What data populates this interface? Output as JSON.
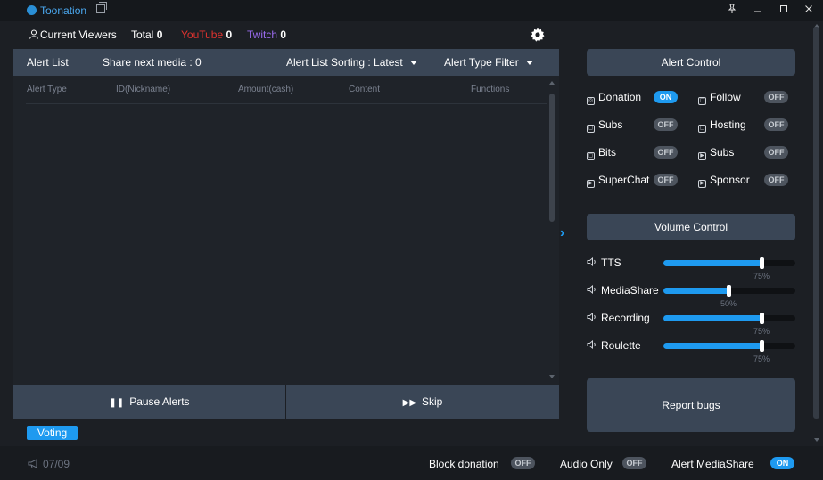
{
  "window": {
    "app_title": "Toonation",
    "icons": [
      "toonation-logo-icon",
      "restore-window-icon",
      "pin-icon",
      "minimize-icon",
      "maximize-icon",
      "close-icon"
    ]
  },
  "stats": {
    "viewers_label": "Current Viewers",
    "total_label": "Total",
    "total_value": "0",
    "youtube_label": "YouTube",
    "youtube_value": "0",
    "twitch_label": "Twitch",
    "twitch_value": "0"
  },
  "alert_list": {
    "title": "Alert List",
    "share_next_media": "Share next media : 0",
    "sorting": "Alert List Sorting : Latest",
    "type_filter": "Alert Type Filter",
    "columns": [
      "Alert Type",
      "ID(Nickname)",
      "Amount(cash)",
      "Content",
      "Functions"
    ],
    "pause_label": "Pause Alerts",
    "skip_label": "Skip"
  },
  "voting_label": "Voting",
  "alert_control": {
    "title": "Alert Control",
    "items": [
      {
        "label": "Donation",
        "state": "ON",
        "icon": "donation-icon"
      },
      {
        "label": "Follow",
        "state": "OFF",
        "icon": "twitch-icon"
      },
      {
        "label": "Subs",
        "state": "OFF",
        "icon": "twitch-icon"
      },
      {
        "label": "Hosting",
        "state": "OFF",
        "icon": "twitch-icon"
      },
      {
        "label": "Bits",
        "state": "OFF",
        "icon": "twitch-icon"
      },
      {
        "label": "Subs",
        "state": "OFF",
        "icon": "youtube-icon"
      },
      {
        "label": "SuperChat",
        "state": "OFF",
        "icon": "youtube-icon"
      },
      {
        "label": "Sponsor",
        "state": "OFF",
        "icon": "youtube-icon"
      }
    ]
  },
  "volume_control": {
    "title": "Volume Control",
    "items": [
      {
        "label": "TTS",
        "value": 0.75,
        "percent": "75%"
      },
      {
        "label": "MediaShare",
        "value": 0.5,
        "percent": "50%"
      },
      {
        "label": "Recording",
        "value": 0.75,
        "percent": "75%"
      },
      {
        "label": "Roulette",
        "value": 0.75,
        "percent": "75%"
      }
    ]
  },
  "report_bugs": "Report bugs",
  "footer": {
    "date": "07/09",
    "block_donation": "Block donation",
    "block_donation_state": "OFF",
    "audio_only": "Audio Only",
    "audio_only_state": "OFF",
    "alert_mediashare": "Alert MediaShare",
    "alert_mediashare_state": "ON"
  },
  "colors": {
    "accent": "#1e9af0",
    "panel": "#3a4656",
    "background": "#1c1f24",
    "youtube": "#e0332f",
    "twitch": "#9b6cf0"
  }
}
